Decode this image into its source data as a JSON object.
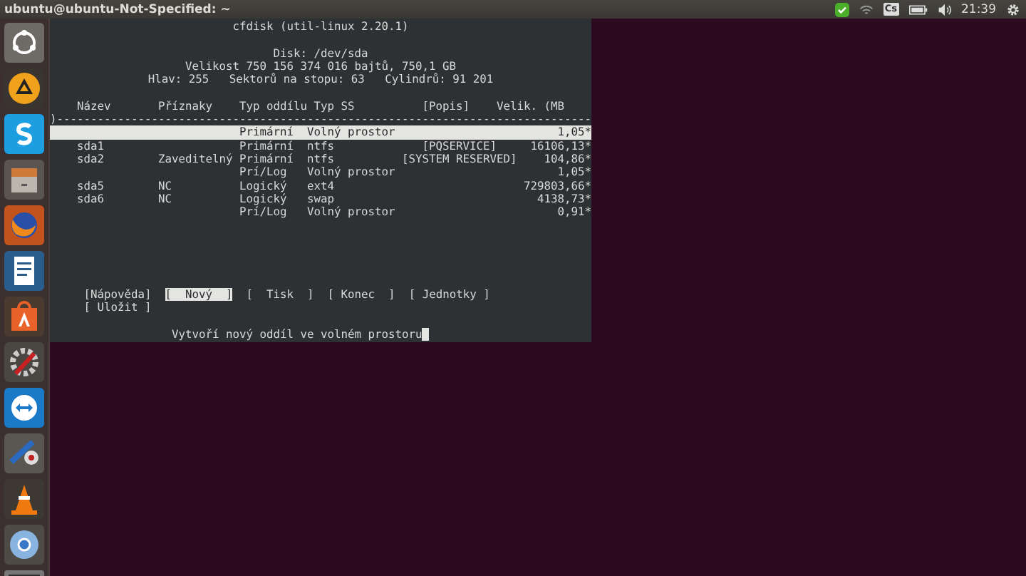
{
  "top_bar": {
    "title": "ubuntu@ubuntu-Not-Specified: ~",
    "keyboard": "Cs",
    "time": "21:39"
  },
  "terminal": {
    "title": "cfdisk (util-linux 2.20.1)",
    "disk_lines": [
      "Disk: /dev/sda",
      "Velikost 750 156 374 016 bajtů, 750,1 GB",
      "Hlav: 255   Sektorů na stopu: 63   Cylindrů: 91 201"
    ],
    "columns": [
      "Název",
      "Příznaky",
      "Typ oddílu",
      "Typ SS",
      "[Popis]",
      "Velik. (MB"
    ],
    "separator": ")-------------------------------------------------------------------------------",
    "rows": [
      {
        "name": "",
        "flags": "",
        "type": "Primární",
        "fs": "Volný prostor",
        "label": "",
        "size": "1,05*",
        "selected": true
      },
      {
        "name": "sda1",
        "flags": "",
        "type": "Primární",
        "fs": "ntfs",
        "label": "[PQSERVICE]",
        "size": "16106,13*",
        "selected": false
      },
      {
        "name": "sda2",
        "flags": "Zaveditelný",
        "type": "Primární",
        "fs": "ntfs",
        "label": "[SYSTEM RESERVED]",
        "size": "104,86*",
        "selected": false
      },
      {
        "name": "",
        "flags": "",
        "type": "Prí/Log",
        "fs": "Volný prostor",
        "label": "",
        "size": "1,05*",
        "selected": false
      },
      {
        "name": "sda5",
        "flags": "NC",
        "type": "Logický",
        "fs": "ext4",
        "label": "",
        "size": "729803,66*",
        "selected": false
      },
      {
        "name": "sda6",
        "flags": "NC",
        "type": "Logický",
        "fs": "swap",
        "label": "",
        "size": "4138,73*",
        "selected": false
      },
      {
        "name": "",
        "flags": "",
        "type": "Prí/Log",
        "fs": "Volný prostor",
        "label": "",
        "size": "0,91*",
        "selected": false
      }
    ],
    "menu": [
      {
        "label": "[Nápověda]",
        "selected": false
      },
      {
        "label": "[  Nový  ]",
        "selected": true
      },
      {
        "label": "[  Tisk  ]",
        "selected": false
      },
      {
        "label": "[ Konec  ]",
        "selected": false
      },
      {
        "label": "[ Jednotky ]",
        "selected": false
      },
      {
        "label": "[ Uložit ]",
        "selected": false
      }
    ],
    "status": "Vytvoří nový oddíl ve volném prostoru"
  }
}
